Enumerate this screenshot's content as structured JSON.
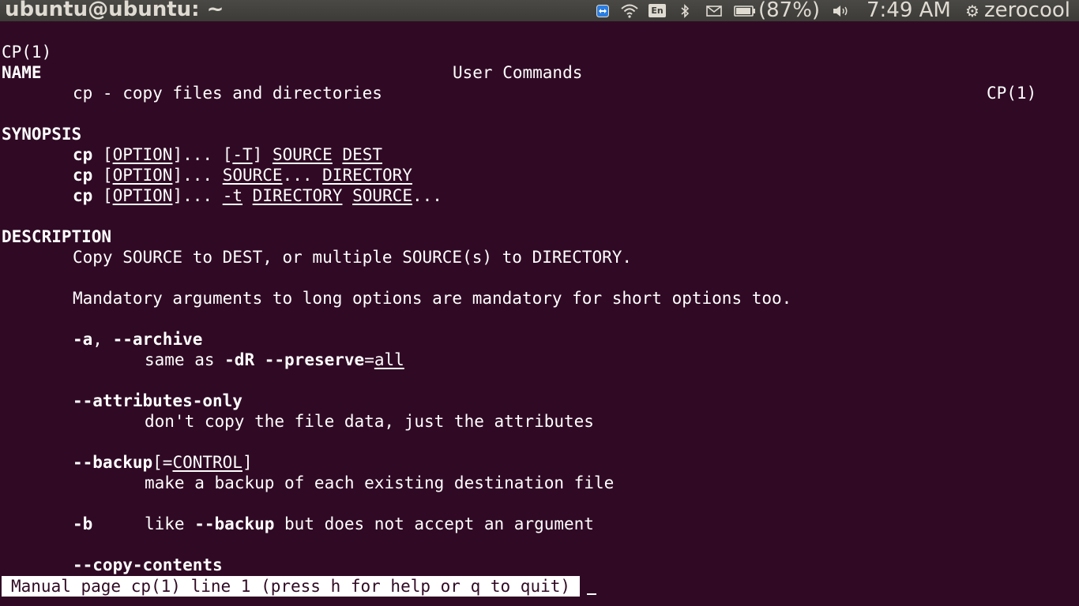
{
  "panel": {
    "window_title": "ubuntu@ubuntu: ~",
    "battery_text": "(87%)",
    "clock": "7:49 AM",
    "username": "zerocool",
    "keyboard_layout": "En",
    "icons": [
      "teamviewer-icon",
      "wifi-icon",
      "keyboard-layout-icon",
      "bluetooth-icon",
      "mail-icon",
      "battery-icon",
      "sound-icon",
      "gear-icon"
    ]
  },
  "man": {
    "header_left": "CP(1)",
    "header_center": "User Commands",
    "header_right": "CP(1)",
    "name_heading": "NAME",
    "name_text": "cp - copy files and directories",
    "synopsis_heading": "SYNOPSIS",
    "synopsis_cmd": "cp",
    "synopsis_option": "OPTION",
    "synopsis_ellipsis": "...",
    "synopsis_T": "-T",
    "synopsis_t": "-t",
    "synopsis_source": "SOURCE",
    "synopsis_dest": "DEST",
    "synopsis_directory": "DIRECTORY",
    "description_heading": "DESCRIPTION",
    "desc_line1": "Copy SOURCE to DEST, or multiple SOURCE(s) to DIRECTORY.",
    "desc_line2": "Mandatory arguments to long options are mandatory for short options too.",
    "opt_a_short": "-a",
    "opt_a_long": "--archive",
    "opt_a_desc_prefix": "same as ",
    "opt_a_desc_dR": "-dR",
    "opt_a_desc_preserve": "--preserve",
    "opt_a_desc_all": "all",
    "opt_attr": "--attributes-only",
    "opt_attr_desc": "don't copy the file data, just the attributes",
    "opt_backup": "--backup",
    "opt_backup_control": "CONTROL",
    "opt_backup_desc": "make a backup of each existing destination file",
    "opt_b": "-b",
    "opt_b_desc_prefix": "like ",
    "opt_b_desc_backup": "--backup",
    "opt_b_desc_suffix": " but does not accept an argument",
    "opt_copy_contents": "--copy-contents"
  },
  "status_bar": "Manual page cp(1) line 1 (press h for help or q to quit)"
}
